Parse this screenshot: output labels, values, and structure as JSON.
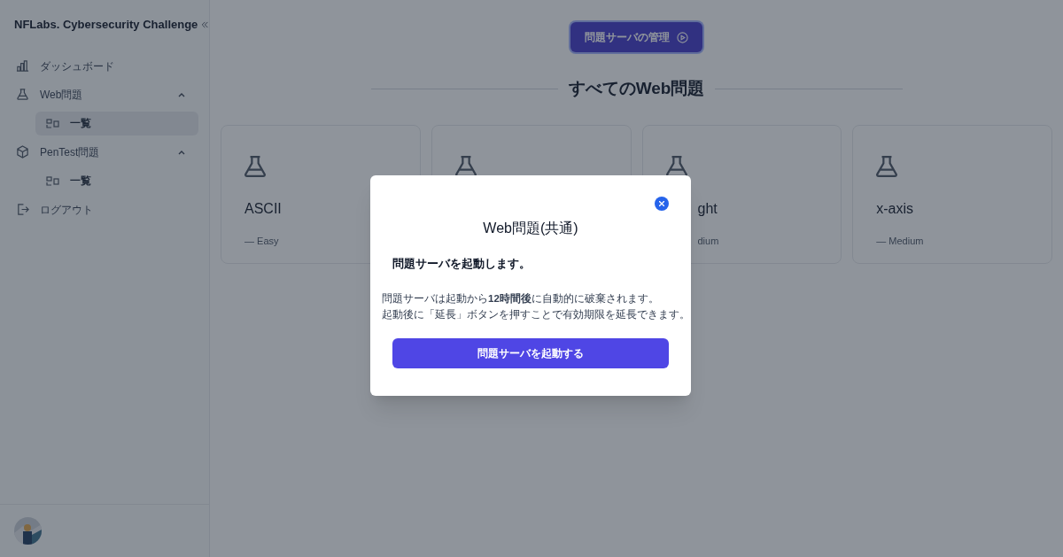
{
  "sidebar": {
    "title": "NFLabs. Cybersecurity Challenge",
    "items": [
      {
        "label": "ダッシュボード"
      },
      {
        "label": "Web問題",
        "expanded": true,
        "children": [
          {
            "label": "一覧",
            "selected": true
          }
        ]
      },
      {
        "label": "PenTest問題",
        "expanded": true,
        "children": [
          {
            "label": "一覧",
            "selected": false
          }
        ]
      },
      {
        "label": "ログアウト"
      }
    ]
  },
  "manage_button": "問題サーバの管理",
  "heading": "すべてのWeb問題",
  "cards": [
    {
      "kind": "challenge",
      "title": "ASCII",
      "level_text": "— Easy"
    },
    {
      "kind": "challenge"
    },
    {
      "kind": "challenge",
      "title": "ght",
      "level_text": "dium",
      "cut_left": true
    },
    {
      "kind": "challenge",
      "title": "x-axis",
      "level_text": "— Medium"
    }
  ],
  "modal": {
    "title": "Web問題(共通)",
    "lead": "問題サーバを起動します。",
    "body": [
      "問題サーバは起動から**12時間後**に自動的に破棄されます。",
      "起動後に「延長」ボタンを押すことで有効期限を延長できます。"
    ],
    "button": "問題サーバを起動する"
  }
}
